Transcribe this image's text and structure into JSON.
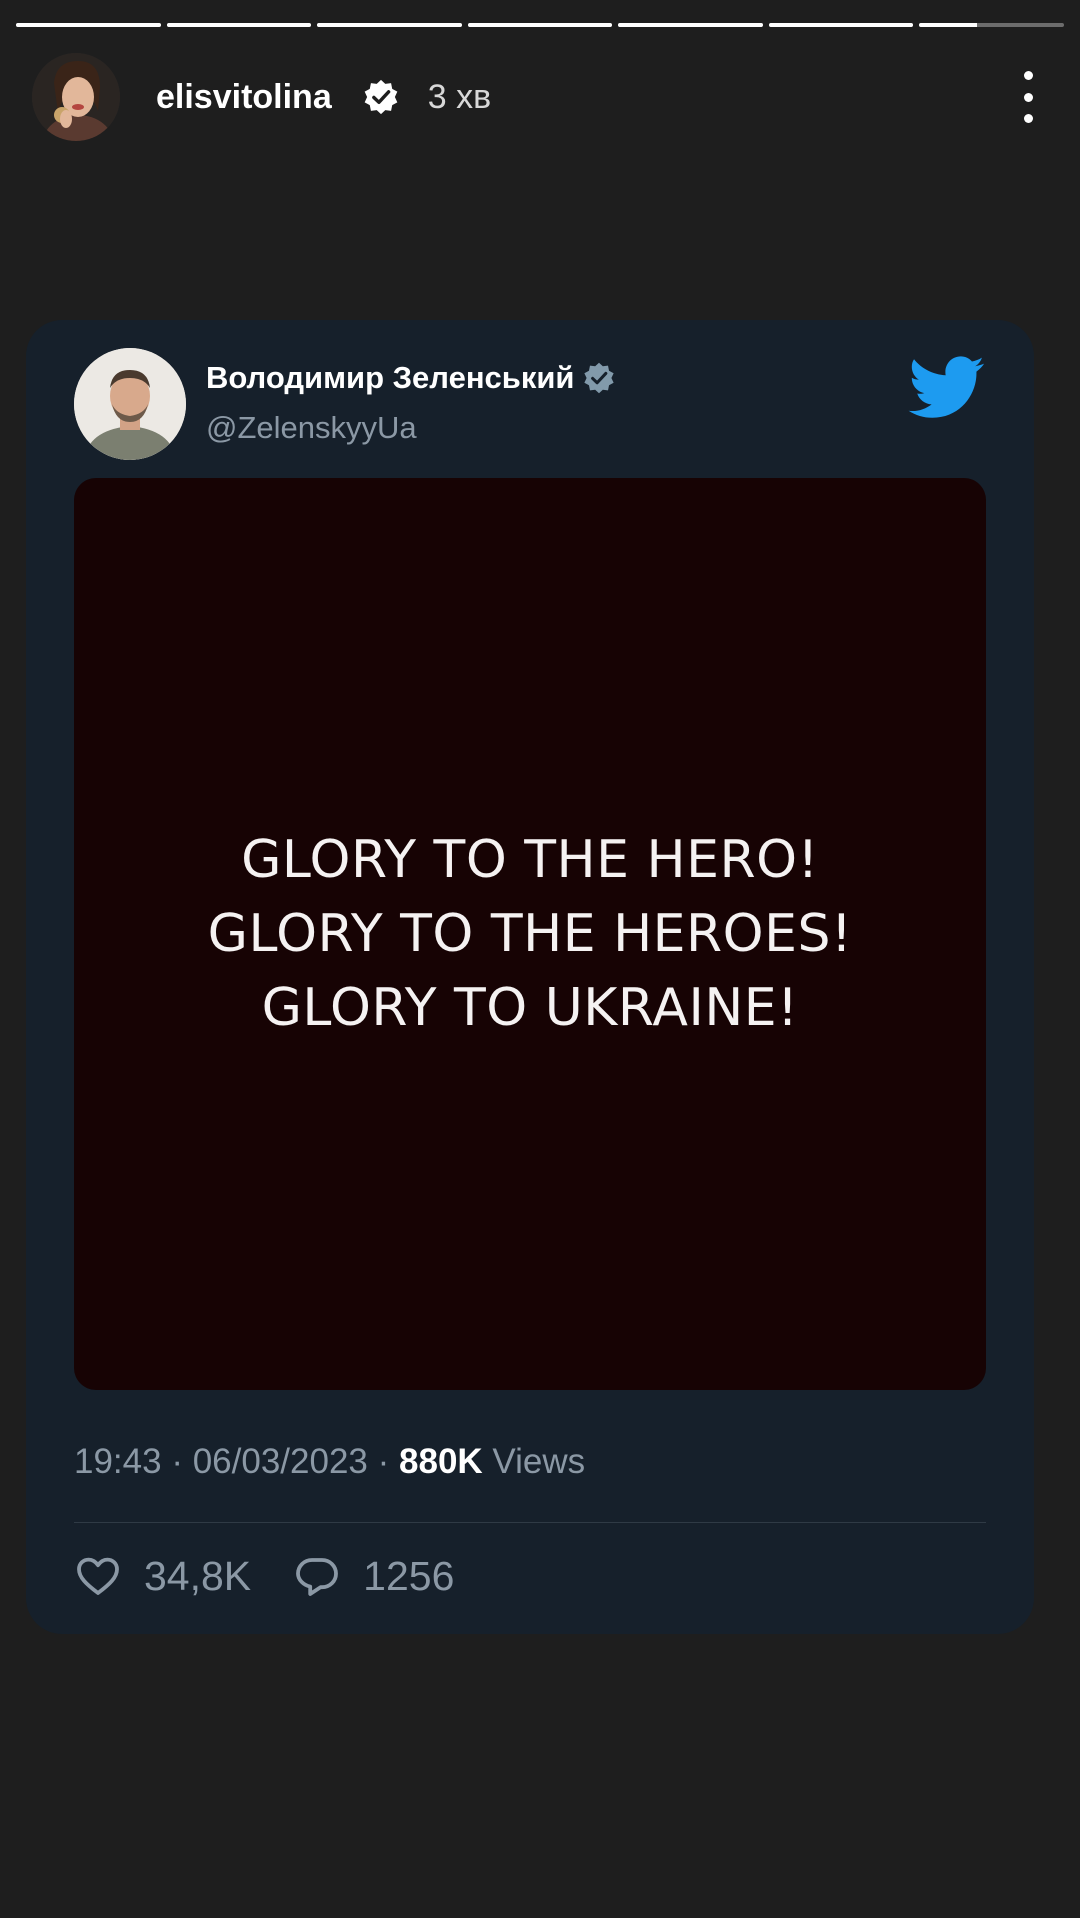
{
  "story": {
    "segments_total": 7,
    "segments_completed": 6,
    "current_segment_progress": 0.4,
    "user": {
      "username": "elisvitolina",
      "verified": true,
      "time_ago": "3 хв"
    },
    "icons": {
      "verified": "verified-badge-icon",
      "more": "more-vertical-icon"
    }
  },
  "tweet": {
    "author": {
      "name": "Володимир Зеленський",
      "handle": "@ZelenskyyUa",
      "verified": true
    },
    "media": {
      "lines": [
        "GLORY TO THE HERO!",
        "GLORY TO THE HEROES!",
        "GLORY TO UKRAINE!"
      ]
    },
    "meta": {
      "time": "19:43",
      "separator": "·",
      "date": "06/03/2023",
      "views_count": "880K",
      "views_label": "Views"
    },
    "stats": {
      "likes": "34,8K",
      "replies": "1256"
    },
    "icons": {
      "brand": "twitter-bird-icon",
      "like": "heart-icon",
      "reply": "reply-bubble-icon"
    }
  },
  "colors": {
    "background": "#1e1e1e",
    "card": "#16202b",
    "media": "#170304",
    "twitter_blue": "#1d9bf0",
    "muted": "#8b98a5"
  }
}
